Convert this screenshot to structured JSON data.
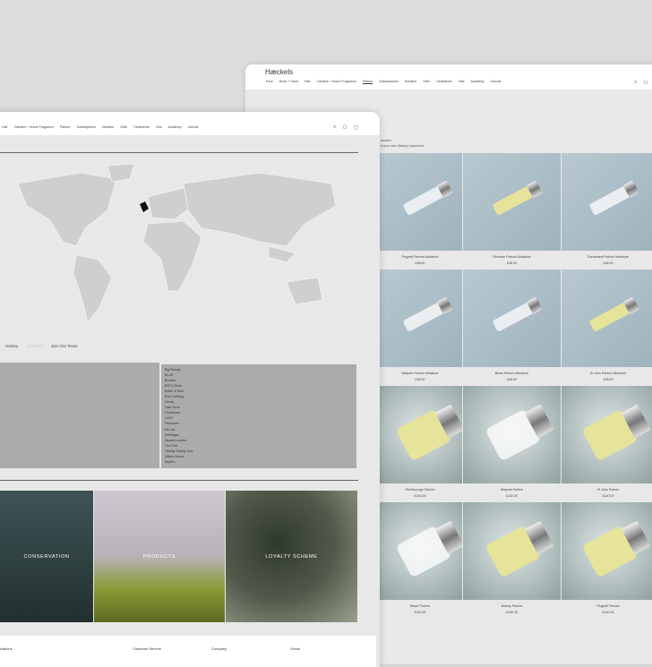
{
  "back_page": {
    "logo": "Hæckels",
    "nav": [
      "Face",
      "Body + Hand",
      "Hair",
      "Candles + Home Fragrance",
      "Parfum",
      "Subscriptions",
      "Nutrition",
      "Gifts",
      "Treatments",
      "Visit",
      "Academy",
      "Journal"
    ],
    "active_nav": "Parfum",
    "intro": [
      "n location.",
      "s of your own olfactory experience."
    ],
    "products": [
      {
        "name": "Pegwell Parfum Miniature",
        "price": "£38.00",
        "kind": "mini",
        "liquid": "clear"
      },
      {
        "name": "Reculver Parfum Miniature",
        "price": "£38.00",
        "kind": "mini",
        "liquid": "yellow"
      },
      {
        "name": "Dreamland Parfum Miniature",
        "price": "£38.00",
        "kind": "mini",
        "liquid": "clear"
      },
      {
        "name": "Walpole Parfum Miniature",
        "price": "£38.00",
        "kind": "mini",
        "liquid": "clear"
      },
      {
        "name": "Blean Parfum Miniature",
        "price": "£38.00",
        "kind": "mini",
        "liquid": "clear"
      },
      {
        "name": "St John Parfum Miniature",
        "price": "£38.00",
        "kind": "mini",
        "liquid": "yellow"
      },
      {
        "name": "Richborough Parfum",
        "price": "£140.00",
        "kind": "full",
        "liquid": "yellow"
      },
      {
        "name": "Walpole Parfum",
        "price": "£140.00",
        "kind": "full",
        "liquid": "clear"
      },
      {
        "name": "St John Parfum",
        "price": "£140.00",
        "kind": "full",
        "liquid": "yellow"
      },
      {
        "name": "Blean Parfum",
        "price": "£140.00",
        "kind": "full",
        "liquid": "clear"
      },
      {
        "name": "Botany Parfum",
        "price": "£140.00",
        "kind": "full",
        "liquid": "yellow"
      },
      {
        "name": "Pegwell Parfum",
        "price": "£140.00",
        "kind": "full",
        "liquid": "yellow"
      }
    ]
  },
  "front_page": {
    "nav": [
      "Hair",
      "Candles + Home Fragrance",
      "Parfum",
      "Subscriptions",
      "Nutrition",
      "Gifts",
      "Treatments",
      "Visit",
      "Academy",
      "Journal"
    ],
    "tabs": [
      "History",
      "Stockists",
      "Join Our Team"
    ],
    "stockists": [
      "Big Beauty",
      "BLOK",
      "Browns",
      "BSTN Store",
      "Butler & Rice",
      "End Clothing",
      "Gently",
      "Halo Store",
      "Goodhood",
      "LNCC",
      "Pavement",
      "Re Lax",
      "Selfridges",
      "Stuarts London",
      "The Find",
      "Twenty Twenty One",
      "Watch House",
      "Wylie's"
    ],
    "tiles": [
      "CONSERVATION",
      "PRODUCTS",
      "LOYALTY SCHEME"
    ],
    "footer": {
      "left": "ications",
      "cols": [
        "Customer Service",
        "Company",
        "Social"
      ]
    }
  }
}
